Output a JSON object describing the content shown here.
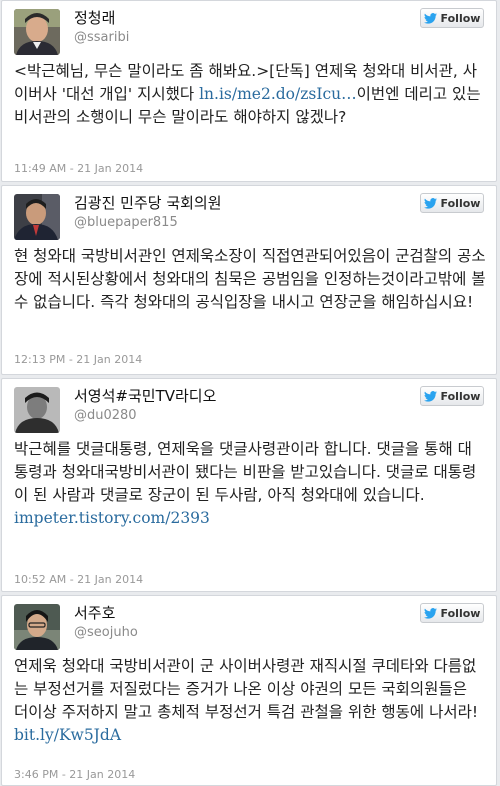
{
  "follow_label": "Follow",
  "colors": {
    "link": "#2a6b9e",
    "twitter_bird": "#2aa3ef"
  },
  "tweets": [
    {
      "name": "정청래",
      "handle": "@ssaribi",
      "text": "<박근혜님, 무슨 말이라도 좀 해봐요.>[단독] 연제욱 청와대 비서관, 사이버사 '대선 개입' 지시했다 ",
      "link": "ln.is/me2.do/zsIcu…",
      "text_after": "이번엔 데리고 있는 비서관의 소행이니 무슨 말이라도 해야하지 않겠나?",
      "timestamp": "11:49 AM - 21 Jan 2014",
      "avatar_icon": "person-photo"
    },
    {
      "name": "김광진 민주당 국회의원",
      "handle": "@bluepaper815",
      "text": "현 청와대 국방비서관인 연제욱소장이 직접연관되어있음이 군검찰의 공소장에 적시된상황에서 청와대의 침묵은 공범임을 인정하는것이라고밖에 볼 수 없습니다. 즉각 청와대의 공식입장을 내시고 연장군을 해임하십시요!",
      "link": "",
      "text_after": "",
      "timestamp": "12:13 PM - 21 Jan 2014",
      "avatar_icon": "person-photo"
    },
    {
      "name": "서영석#국민TV라디오",
      "handle": "@du0280",
      "text": "박근혜를 댓글대통령, 연제욱을 댓글사령관이라 합니다. 댓글을 통해 대통령과 청와대국방비서관이 됐다는 비판을 받고있습니다. 댓글로 대통령이 된 사람과 댓글로 장군이 된 두사람, 아직 청와대에 있습니다. ",
      "link": "impeter.tistory.com/2393",
      "text_after": "",
      "timestamp": "10:52 AM - 21 Jan 2014",
      "avatar_icon": "person-photo"
    },
    {
      "name": "서주호",
      "handle": "@seojuho",
      "text": "연제욱 청와대 국방비서관이 군 사이버사령관 재직시절 쿠데타와 다름없는 부정선거를 저질렀다는 증거가 나온 이상 야권의 모든 국회의원들은 더이상 주저하지 말고 총체적 부정선거 특검 관철을 위한 행동에 나서라! ",
      "link": "bit.ly/Kw5JdA",
      "text_after": "",
      "timestamp": "3:46 PM - 21 Jan 2014",
      "avatar_icon": "person-photo"
    }
  ]
}
